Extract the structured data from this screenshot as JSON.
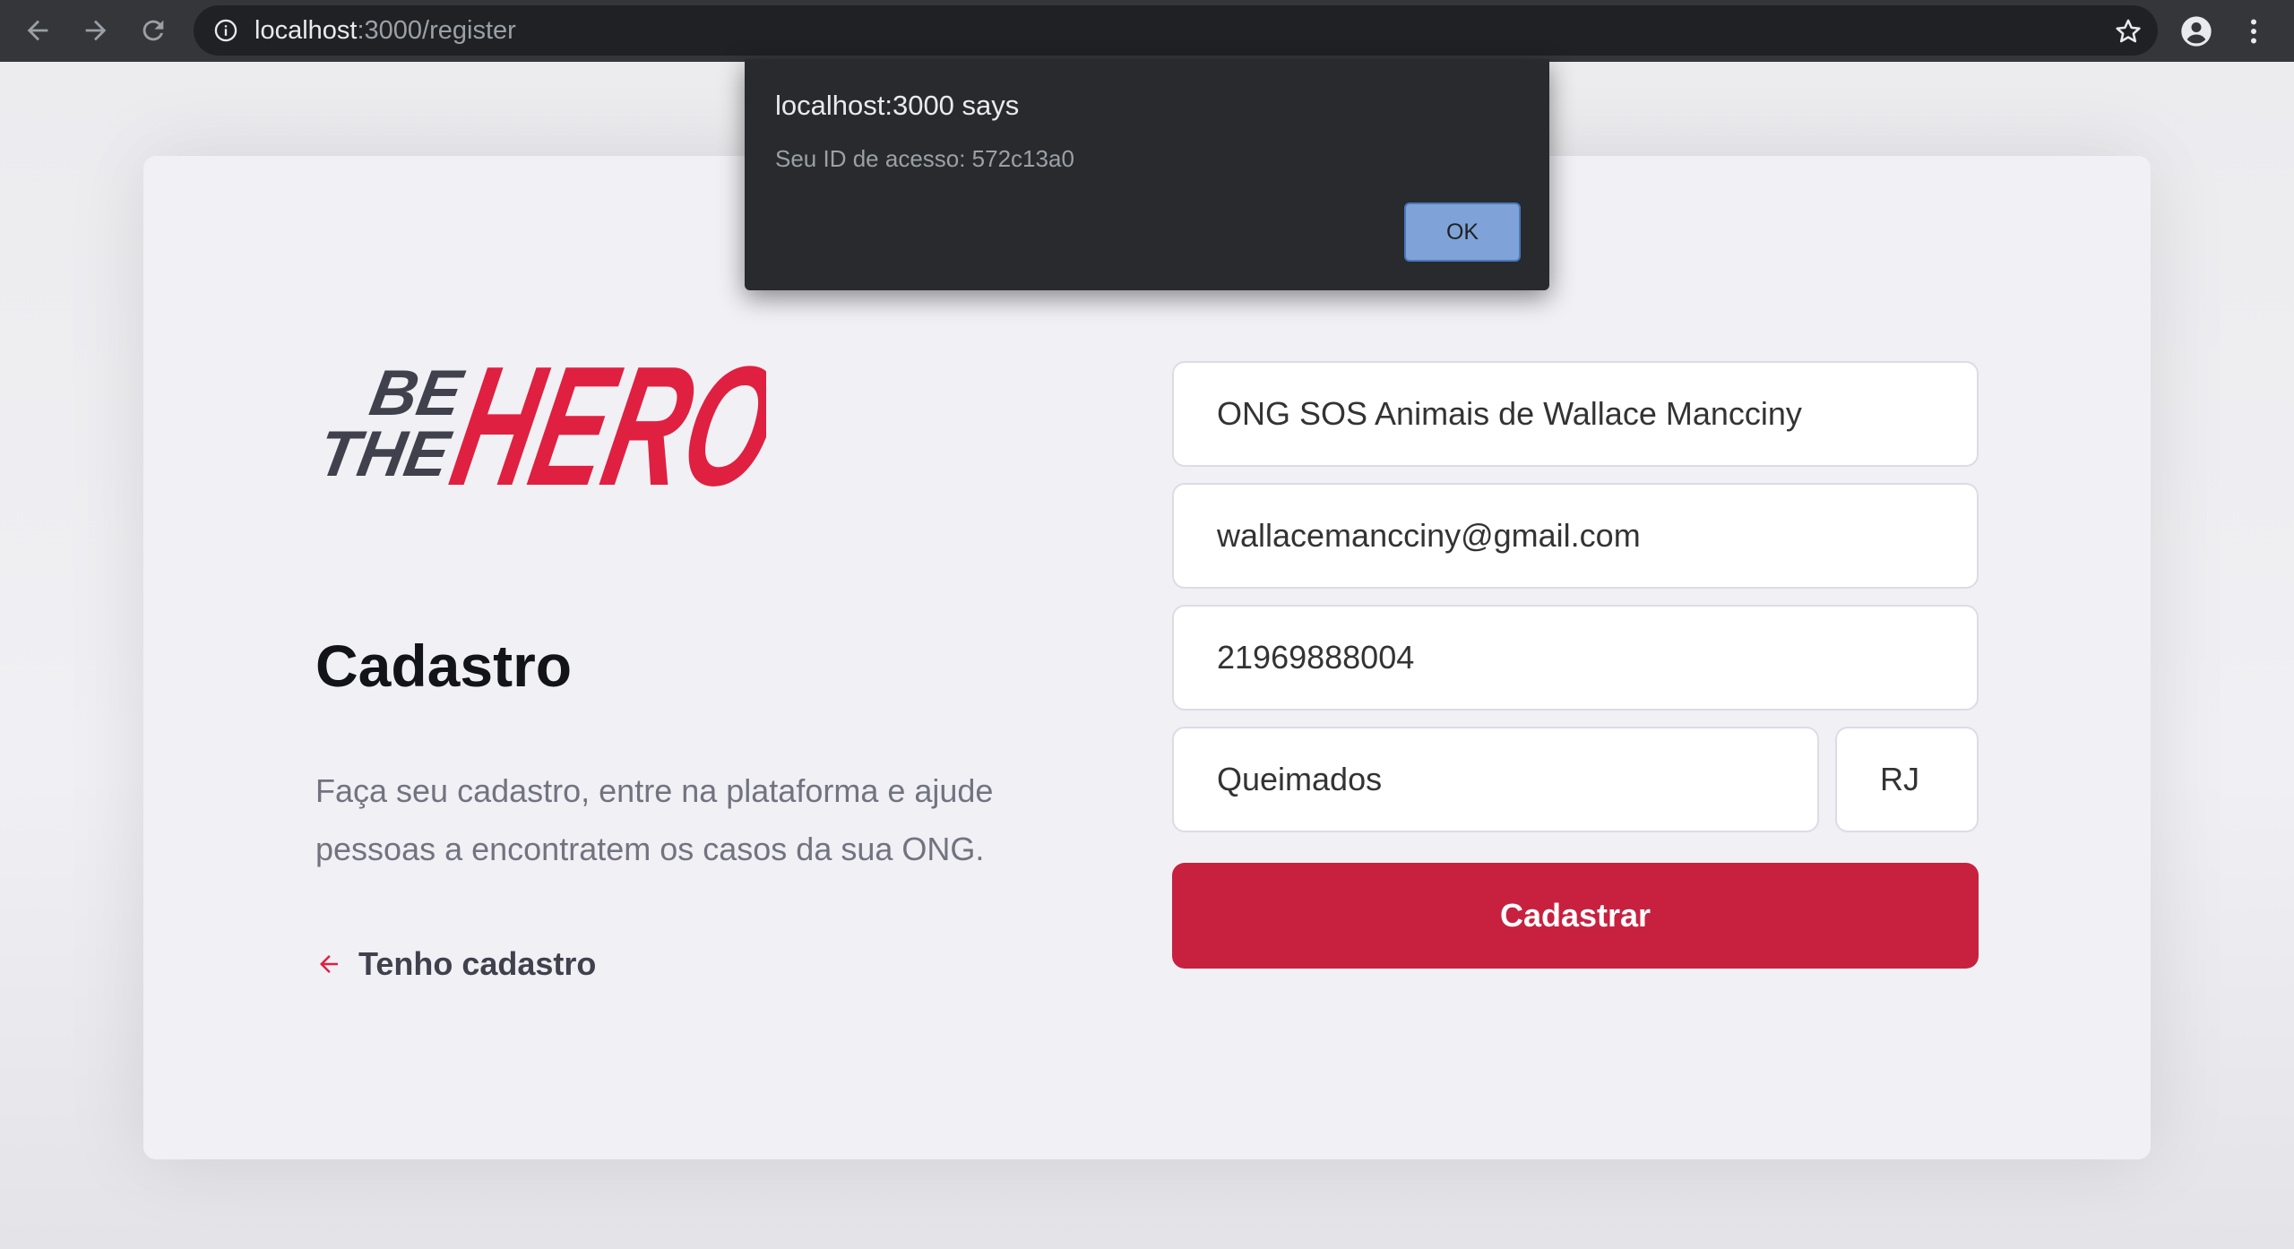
{
  "browser": {
    "url_host": "localhost",
    "url_path": ":3000/register",
    "icons": {
      "back": "arrow-left-icon",
      "forward": "arrow-right-icon",
      "reload": "reload-icon",
      "info": "info-icon",
      "bookmark": "star-icon",
      "profile": "account-circle-icon",
      "menu": "kebab-menu-icon"
    }
  },
  "dialog": {
    "title": "localhost:3000 says",
    "message": "Seu ID de acesso: 572c13a0",
    "ok_label": "OK"
  },
  "logo": {
    "line1": "BE",
    "line2": "THE",
    "word": "HERO",
    "color_accent": "#e02041",
    "color_dark": "#41414d"
  },
  "main": {
    "title": "Cadastro",
    "description": "Faça seu cadastro, entre na plataforma e ajude pessoas a encontratem os casos da sua ONG.",
    "back_link_label": "Tenho cadastro"
  },
  "form": {
    "name_value": "ONG SOS Animais de Wallace Mancciny",
    "email_value": "wallacemancciny@gmail.com",
    "whatsapp_value": "21969888004",
    "city_value": "Queimados",
    "uf_value": "RJ",
    "submit_label": "Cadastrar"
  },
  "colors": {
    "primary": "#e02041",
    "button": "#c7213f",
    "background": "#f0f0f5"
  }
}
